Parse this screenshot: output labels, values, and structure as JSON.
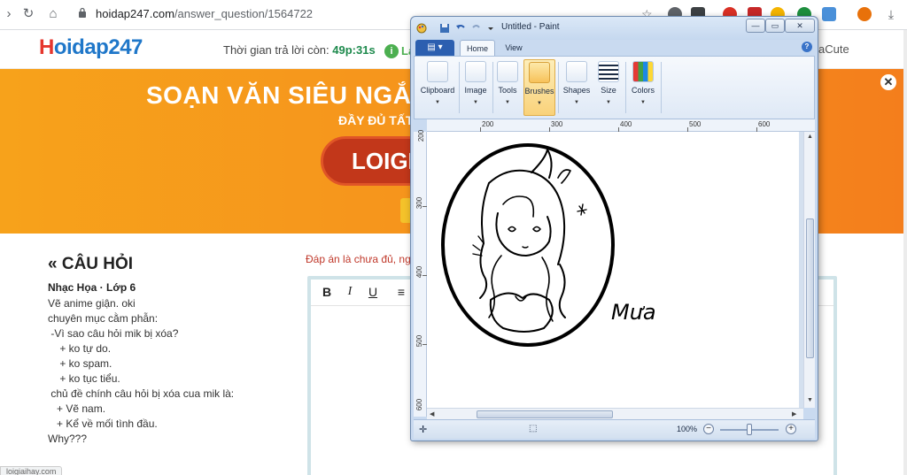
{
  "browser": {
    "url_domain": "hoidap247.com",
    "url_path": "/answer_question/1564722"
  },
  "site": {
    "logo_text": "Hoidap247",
    "logo_first": "H",
    "logo_rest": "oidap247",
    "timer_label": "Thời gian trả lời còn:",
    "timer_value": "49p:31s",
    "info_icon": "i",
    "info_text": "La",
    "user_partial": "aCute"
  },
  "banner": {
    "title": "SOẠN VĂN SIÊU NGẮN",
    "subtitle": "ĐẦY ĐỦ TẤT",
    "button_text": "LOIGI",
    "close_glyph": "✕"
  },
  "question": {
    "heading": "« CÂU HỎI",
    "meta": "Nhạc Họa · Lớp 6",
    "lines": [
      "Vẽ anime giận. oki",
      "chuyên mục cằm phẫn:",
      " -Vì sao câu hỏi mik bị xóa?",
      "    + ko tự do.",
      "    + ko spam.",
      "    + ko tục tiểu.",
      " chủ đề chính câu hỏi bị xóa cua mik là:",
      "   + Vẽ nam.",
      "   + Kể về mối tình đầu.",
      "Why???"
    ],
    "status_link": "loigiaihay.com"
  },
  "answer": {
    "warning": "Đáp án là chưa đủ, ng",
    "toolbar": {
      "bold": "B",
      "italic": "I",
      "underline": "U",
      "align": "≡"
    }
  },
  "paint": {
    "title": "Untitled - Paint",
    "tabs": [
      "Home",
      "View"
    ],
    "groups": [
      {
        "label": "Clipboard",
        "icon": "clipboard-icon"
      },
      {
        "label": "Image",
        "icon": "image-icon"
      },
      {
        "label": "Tools",
        "icon": "tools-icon"
      },
      {
        "label": "Brushes",
        "icon": "brush-icon"
      },
      {
        "label": "Shapes",
        "icon": "shapes-icon"
      },
      {
        "label": "Size",
        "icon": "size-icon"
      },
      {
        "label": "Colors",
        "icon": "colors-icon"
      }
    ],
    "ruler_top": [
      "200",
      "300",
      "400",
      "500",
      "600"
    ],
    "ruler_left": [
      "200",
      "300",
      "400",
      "500",
      "600"
    ],
    "drawing_text": "Mưa",
    "zoom": "100%",
    "zoom_out": "−",
    "zoom_in": "+",
    "win_min": "—",
    "win_max": "▭",
    "win_close": "✕"
  },
  "colors": {
    "banner_orange": "#f5901c",
    "logo_blue": "#1f77c9",
    "timer_green": "#1e8a4d",
    "warning_red": "#c0392b",
    "paint_frame": "#c9daf0"
  }
}
